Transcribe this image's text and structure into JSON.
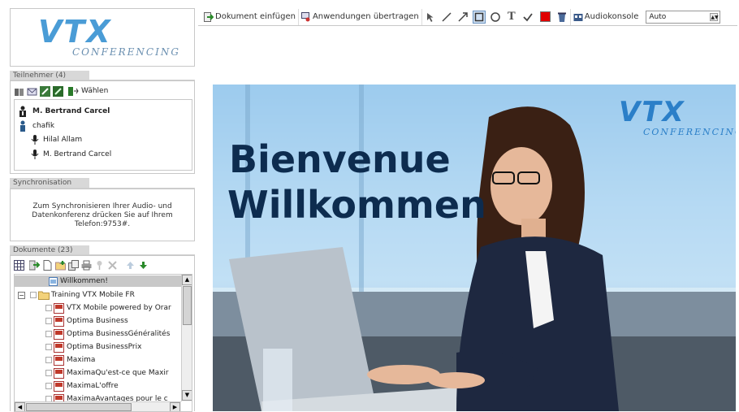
{
  "logo": {
    "brand": "VTX",
    "sub": "CONFERENCING"
  },
  "participants": {
    "title": "Teilnehmer (4)",
    "dial_label": "Wählen",
    "people": [
      {
        "name": "M. Bertrand Carcel",
        "bold": true,
        "role": "moderator-icon"
      },
      {
        "name": "chafik",
        "bold": false,
        "role": "user-icon"
      },
      {
        "name": "Hilal Allam",
        "bold": false,
        "role": "microphone-icon"
      },
      {
        "name": "M. Bertrand Carcel",
        "bold": false,
        "role": "microphone-icon"
      }
    ]
  },
  "sync": {
    "title": "Synchronisation",
    "text": "Zum Synchronisieren Ihrer Audio- und Datenkonferenz drücken Sie auf Ihrem Telefon:9753#."
  },
  "documents": {
    "title": "Dokumente (23)",
    "selected": "Willkommen!",
    "folder": "Training VTX Mobile FR",
    "files": [
      "VTX Mobile powered by Orar",
      "Optima Business",
      "Optima BusinessGénéralités",
      "Optima BusinessPrix",
      "Maxima",
      "MaximaQu'est-ce que Maxir",
      "MaximaL'offre",
      "MaximaAvantages pour le c"
    ]
  },
  "toolbar": {
    "insert_doc": "Dokument einfügen",
    "share_apps": "Anwendungen übertragen",
    "audio_console": "Audiokonsole",
    "zoom_value": "Auto",
    "color": "#e00000"
  },
  "slide": {
    "line1": "Bienvenue",
    "line2": "Willkommen",
    "brand": "VTX",
    "brand_sub": "CONFERENCING"
  }
}
